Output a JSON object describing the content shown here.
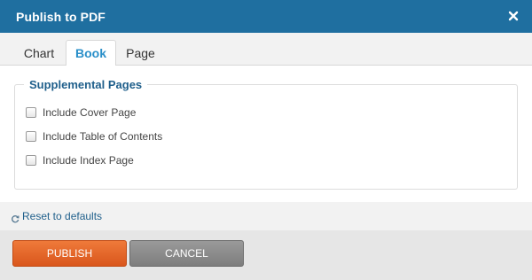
{
  "dialog": {
    "title": "Publish to PDF",
    "close_icon": "close-icon"
  },
  "tabs": [
    {
      "label": "Chart",
      "active": false
    },
    {
      "label": "Book",
      "active": true
    },
    {
      "label": "Page",
      "active": false
    }
  ],
  "supplemental": {
    "legend": "Supplemental Pages",
    "options": [
      {
        "label": "Include Cover Page",
        "checked": false
      },
      {
        "label": "Include Table of Contents",
        "checked": false
      },
      {
        "label": "Include Index Page",
        "checked": false
      }
    ]
  },
  "reset": {
    "label": "Reset to defaults",
    "icon": "refresh-icon"
  },
  "footer": {
    "publish_label": "PUBLISH",
    "cancel_label": "CANCEL"
  },
  "colors": {
    "titlebar": "#1f6fa0",
    "accent": "#2a8fc9",
    "publish": "#e8632a",
    "cancel": "#8a8a8a"
  }
}
